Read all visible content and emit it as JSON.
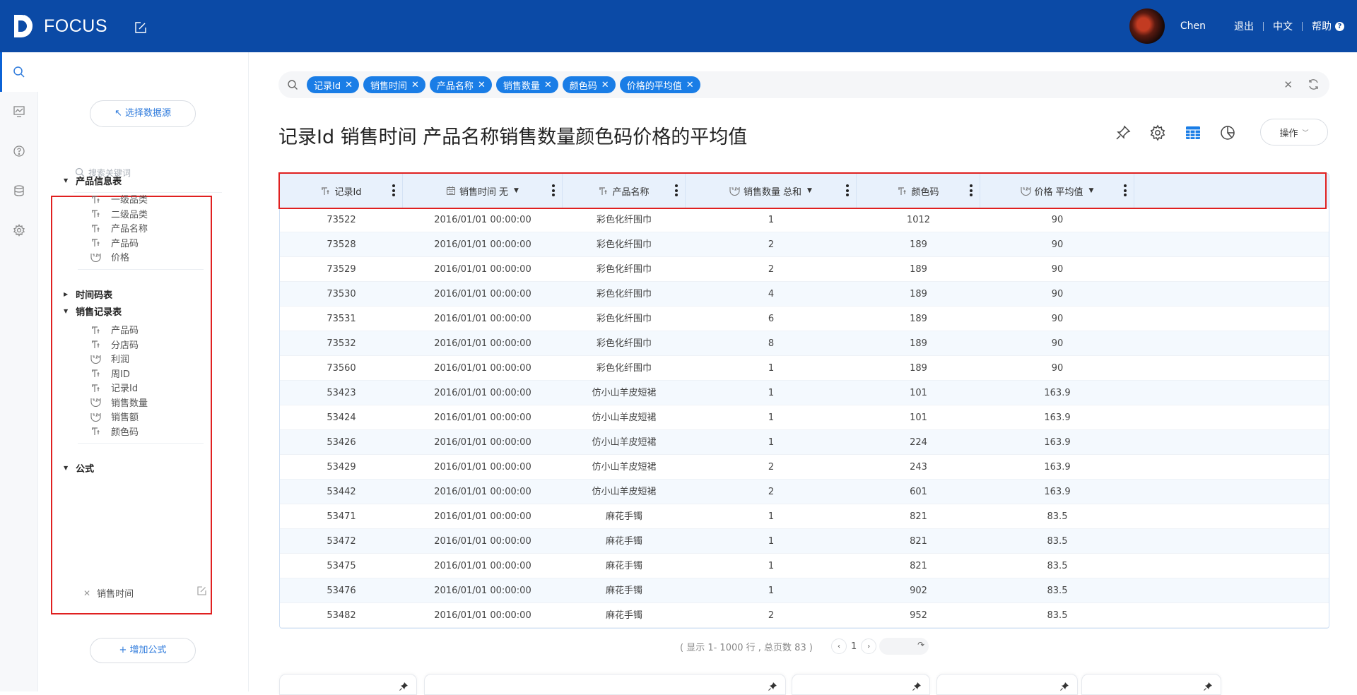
{
  "app": {
    "logo_text": "FOCUS"
  },
  "user": {
    "name": "Chen",
    "logout": "退出",
    "lang": "中文",
    "help": "帮助"
  },
  "panel": {
    "select_source": "↖ 选择数据源",
    "search_placeholder": "搜索关键词",
    "groups": [
      {
        "name": "产品信息表",
        "expanded": true,
        "fields": [
          {
            "label": "一级品类",
            "type": "text"
          },
          {
            "label": "二级品类",
            "type": "text"
          },
          {
            "label": "产品名称",
            "type": "text"
          },
          {
            "label": "产品码",
            "type": "text"
          },
          {
            "label": "价格",
            "type": "number"
          }
        ]
      },
      {
        "name": "时间码表",
        "expanded": false,
        "fields": []
      },
      {
        "name": "销售记录表",
        "expanded": true,
        "fields": [
          {
            "label": "产品码",
            "type": "text"
          },
          {
            "label": "分店码",
            "type": "text"
          },
          {
            "label": "利润",
            "type": "number"
          },
          {
            "label": "周ID",
            "type": "text"
          },
          {
            "label": "记录Id",
            "type": "text"
          },
          {
            "label": "销售数量",
            "type": "number"
          },
          {
            "label": "销售额",
            "type": "number"
          },
          {
            "label": "颜色码",
            "type": "text"
          }
        ]
      },
      {
        "name": "公式",
        "expanded": true,
        "fields": []
      }
    ],
    "formula_item": "销售时间",
    "add_formula": "+ 增加公式"
  },
  "search": {
    "chips": [
      "记录Id",
      "销售时间",
      "产品名称",
      "销售数量",
      "颜色码",
      "价格的平均值"
    ]
  },
  "title": "记录Id 销售时间 产品名称销售数量颜色码价格的平均值",
  "ops_label": "操作",
  "table": {
    "columns": [
      {
        "label": "记录Id",
        "icon": "text",
        "suffix": "",
        "dropdown": false
      },
      {
        "label": "销售时间",
        "icon": "date",
        "suffix": "无",
        "dropdown": true
      },
      {
        "label": "产品名称",
        "icon": "text",
        "suffix": "",
        "dropdown": false
      },
      {
        "label": "销售数量",
        "icon": "number",
        "suffix": "总和",
        "dropdown": true
      },
      {
        "label": "颜色码",
        "icon": "text",
        "suffix": "",
        "dropdown": false
      },
      {
        "label": "价格",
        "icon": "number",
        "suffix": "平均值",
        "dropdown": true
      }
    ],
    "rows": [
      [
        "73522",
        "2016/01/01 00:00:00",
        "彩色化纤围巾",
        "1",
        "1012",
        "90"
      ],
      [
        "73528",
        "2016/01/01 00:00:00",
        "彩色化纤围巾",
        "2",
        "189",
        "90"
      ],
      [
        "73529",
        "2016/01/01 00:00:00",
        "彩色化纤围巾",
        "2",
        "189",
        "90"
      ],
      [
        "73530",
        "2016/01/01 00:00:00",
        "彩色化纤围巾",
        "4",
        "189",
        "90"
      ],
      [
        "73531",
        "2016/01/01 00:00:00",
        "彩色化纤围巾",
        "6",
        "189",
        "90"
      ],
      [
        "73532",
        "2016/01/01 00:00:00",
        "彩色化纤围巾",
        "8",
        "189",
        "90"
      ],
      [
        "73560",
        "2016/01/01 00:00:00",
        "彩色化纤围巾",
        "1",
        "189",
        "90"
      ],
      [
        "53423",
        "2016/01/01 00:00:00",
        "仿小山羊皮短裙",
        "1",
        "101",
        "163.9"
      ],
      [
        "53424",
        "2016/01/01 00:00:00",
        "仿小山羊皮短裙",
        "1",
        "101",
        "163.9"
      ],
      [
        "53426",
        "2016/01/01 00:00:00",
        "仿小山羊皮短裙",
        "1",
        "224",
        "163.9"
      ],
      [
        "53429",
        "2016/01/01 00:00:00",
        "仿小山羊皮短裙",
        "2",
        "243",
        "163.9"
      ],
      [
        "53442",
        "2016/01/01 00:00:00",
        "仿小山羊皮短裙",
        "2",
        "601",
        "163.9"
      ],
      [
        "53471",
        "2016/01/01 00:00:00",
        "麻花手镯",
        "1",
        "821",
        "83.5"
      ],
      [
        "53472",
        "2016/01/01 00:00:00",
        "麻花手镯",
        "1",
        "821",
        "83.5"
      ],
      [
        "53475",
        "2016/01/01 00:00:00",
        "麻花手镯",
        "1",
        "821",
        "83.5"
      ],
      [
        "53476",
        "2016/01/01 00:00:00",
        "麻花手镯",
        "1",
        "902",
        "83.5"
      ],
      [
        "53482",
        "2016/01/01 00:00:00",
        "麻花手镯",
        "2",
        "952",
        "83.5"
      ]
    ]
  },
  "pagination": {
    "summary": "( 显示 1- 1000 行 , 总页数 83 )",
    "current_page": "1"
  },
  "colors": {
    "topbar": "#0b4aa6",
    "chip": "#1a7de6",
    "accent": "#2f7bdc",
    "highlight": "#e02020"
  }
}
